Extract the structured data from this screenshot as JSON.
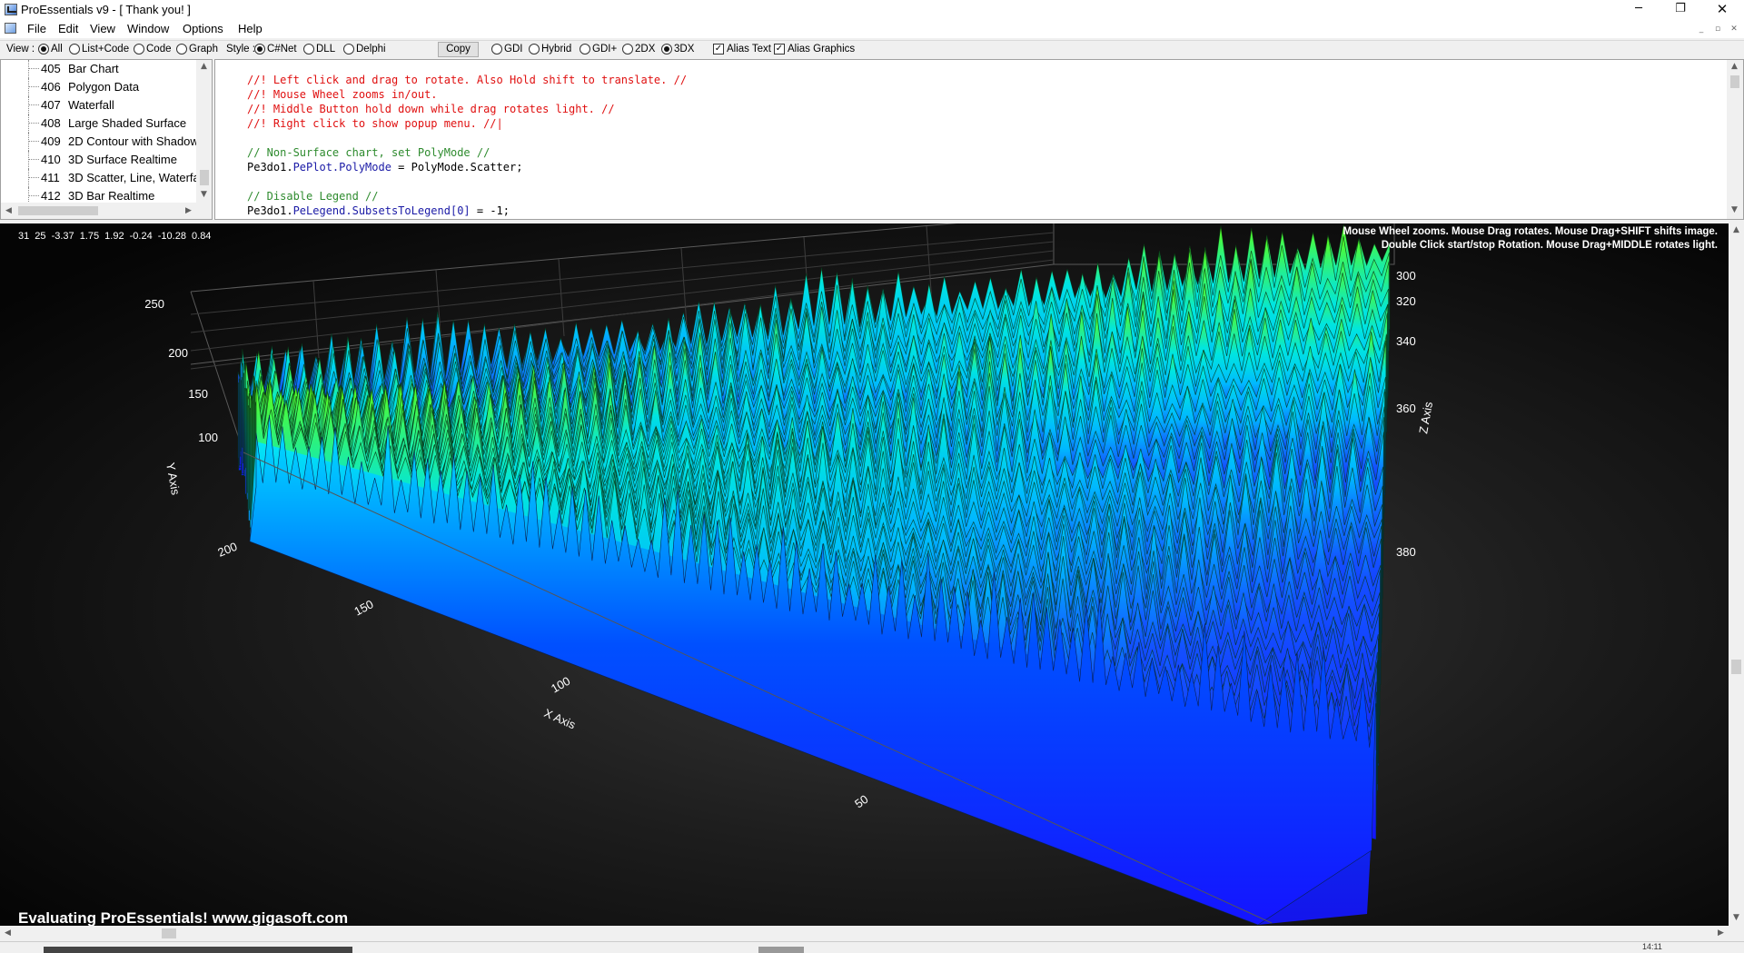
{
  "window": {
    "title": "ProEssentials v9 - [ Thank you! ]",
    "minimize": "─",
    "restore": "❐",
    "close": "✕"
  },
  "menu": {
    "file": "File",
    "edit": "Edit",
    "view": "View",
    "window": "Window",
    "options": "Options",
    "help": "Help"
  },
  "toolbar": {
    "view_label": "View :",
    "view_all": "All",
    "view_list_code": "List+Code",
    "view_code": "Code",
    "view_graph": "Graph",
    "style_label": "Style :",
    "style_csharp": "C#Net",
    "style_dll": "DLL",
    "style_delphi": "Delphi",
    "copy": "Copy",
    "render_gdi": "GDI",
    "render_hybrid": "Hybrid",
    "render_gdiplus": "GDI+",
    "render_2dx": "2DX",
    "render_3dx": "3DX",
    "alias_text": "Alias Text",
    "alias_graphics": "Alias Graphics",
    "view_selected": "All",
    "style_selected": "C#Net",
    "render_selected": "3DX"
  },
  "tree": {
    "items": [
      {
        "num": "405",
        "label": "Bar Chart"
      },
      {
        "num": "406",
        "label": "Polygon Data"
      },
      {
        "num": "407",
        "label": "Waterfall"
      },
      {
        "num": "408",
        "label": "Large Shaded Surface"
      },
      {
        "num": "409",
        "label": "2D Contour with Shadows"
      },
      {
        "num": "410",
        "label": "3D Surface Realtime"
      },
      {
        "num": "411",
        "label": "3D Scatter, Line, Waterfall"
      },
      {
        "num": "412",
        "label": "3D Bar Realtime"
      }
    ]
  },
  "code": {
    "lines": [
      {
        "color": "red",
        "text": "//! Left click and drag to rotate. Also Hold shift to translate. //"
      },
      {
        "color": "red",
        "text": "//! Mouse Wheel zooms in/out."
      },
      {
        "color": "red",
        "text": "//! Middle Button hold down while drag rotates light. //"
      },
      {
        "color": "red",
        "text": "//! Right click to show popup menu. //|"
      },
      {
        "color": "black",
        "text": ""
      },
      {
        "color": "green",
        "text": "// Non-Surface chart, set PolyMode //"
      },
      {
        "color": "mixed",
        "parts": [
          "Pe3do1.",
          "PePlot.PolyMode",
          " = PolyMode.Scatter;"
        ]
      },
      {
        "color": "black",
        "text": ""
      },
      {
        "color": "green",
        "text": "// Disable Legend //"
      },
      {
        "color": "mixed",
        "parts": [
          "Pe3do1.",
          "PeLegend.SubsetsToLegend[0]",
          " = -1;"
        ]
      }
    ]
  },
  "chart": {
    "readout": "31 25 -3.37 1.75 1.92 -0.24 -10.28 0.84",
    "help_line_1": "Mouse Wheel zooms. Mouse Drag rotates. Mouse Drag+SHIFT shifts image.",
    "help_line_2": "Double Click start/stop Rotation. Mouse Drag+MIDDLE rotates light.",
    "eval_text": "Evaluating ProEssentials! www.gigasoft.com",
    "colors": {
      "base": "#1414ff",
      "mid": "#00e5ff",
      "top": "#7dff00",
      "peak": "#d8ff40"
    }
  },
  "chart_data": {
    "type": "surface",
    "title": "",
    "xlabel": "X Axis",
    "ylabel": "Y Axis",
    "zlabel": "Z Axis",
    "x_ticks": [
      "200",
      "150",
      "100",
      "50"
    ],
    "y_ticks": [
      "250",
      "200",
      "150",
      "100"
    ],
    "z_ticks": [
      "300",
      "320",
      "340",
      "360",
      "380"
    ],
    "ylim": [
      100,
      250
    ],
    "colormap": [
      "#1414ff",
      "#00e5ff",
      "#7dff00"
    ],
    "grid": true,
    "legend": "none"
  },
  "status": {
    "time": "14:11"
  }
}
